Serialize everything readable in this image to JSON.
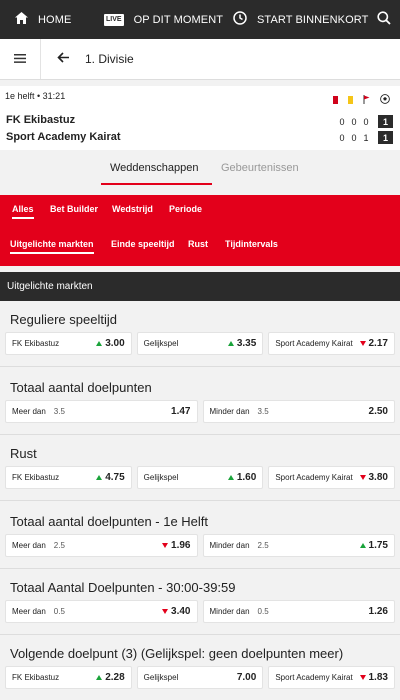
{
  "topnav": {
    "home": "HOME",
    "live_badge": "LIVE",
    "live": "OP DIT MOMENT",
    "soon": "START BINNENKORT"
  },
  "subheader": {
    "title": "1. Divisie"
  },
  "match": {
    "time": "1e helft • 31:21",
    "team1": "FK Ekibastuz",
    "team2": "Sport Academy Kairat",
    "team1_scores": [
      "0",
      "0",
      "0"
    ],
    "team1_total": "1",
    "team2_scores": [
      "0",
      "0",
      "1"
    ],
    "team2_total": "1"
  },
  "tabs": {
    "bets": "Weddenschappen",
    "events": "Gebeurtenissen"
  },
  "filters_row1": [
    "Alles",
    "Bet Builder",
    "Wedstrijd",
    "Periode"
  ],
  "filters_row2": [
    "Uitgelichte markten",
    "Einde speeltijd",
    "Rust",
    "Tijdintervals"
  ],
  "section_header": "Uitgelichte markten",
  "markets": [
    {
      "title": "Reguliere speeltijd",
      "odds": [
        {
          "label": "FK Ekibastuz",
          "line": "",
          "value": "3.00",
          "trend": "up"
        },
        {
          "label": "Gelijkspel",
          "line": "",
          "value": "3.35",
          "trend": "up"
        },
        {
          "label": "Sport Academy Kairat",
          "line": "",
          "value": "2.17",
          "trend": "down"
        }
      ]
    },
    {
      "title": "Totaal aantal doelpunten",
      "odds": [
        {
          "label": "Meer dan",
          "line": "3.5",
          "value": "1.47",
          "trend": ""
        },
        {
          "label": "Minder dan",
          "line": "3.5",
          "value": "2.50",
          "trend": ""
        }
      ]
    },
    {
      "title": "Rust",
      "odds": [
        {
          "label": "FK Ekibastuz",
          "line": "",
          "value": "4.75",
          "trend": "up"
        },
        {
          "label": "Gelijkspel",
          "line": "",
          "value": "1.60",
          "trend": "up"
        },
        {
          "label": "Sport Academy Kairat",
          "line": "",
          "value": "3.80",
          "trend": "down"
        }
      ]
    },
    {
      "title": "Totaal aantal doelpunten - 1e Helft",
      "odds": [
        {
          "label": "Meer dan",
          "line": "2.5",
          "value": "1.96",
          "trend": "down"
        },
        {
          "label": "Minder dan",
          "line": "2.5",
          "value": "1.75",
          "trend": "up"
        }
      ]
    },
    {
      "title": "Totaal Aantal Doelpunten - 30:00-39:59",
      "odds": [
        {
          "label": "Meer dan",
          "line": "0.5",
          "value": "3.40",
          "trend": "down"
        },
        {
          "label": "Minder dan",
          "line": "0.5",
          "value": "1.26",
          "trend": ""
        }
      ]
    },
    {
      "title": "Volgende doelpunt (3) (Gelijkspel: geen doelpunten meer)",
      "odds": [
        {
          "label": "FK Ekibastuz",
          "line": "",
          "value": "2.28",
          "trend": "up"
        },
        {
          "label": "Gelijkspel",
          "line": "",
          "value": "7.00",
          "trend": ""
        },
        {
          "label": "Sport Academy Kairat",
          "line": "",
          "value": "1.83",
          "trend": "down"
        }
      ]
    }
  ],
  "colors": {
    "brand_red": "#e3001b",
    "dark": "#2b2b2b",
    "up": "#1aa33a",
    "down": "#e3001b"
  }
}
